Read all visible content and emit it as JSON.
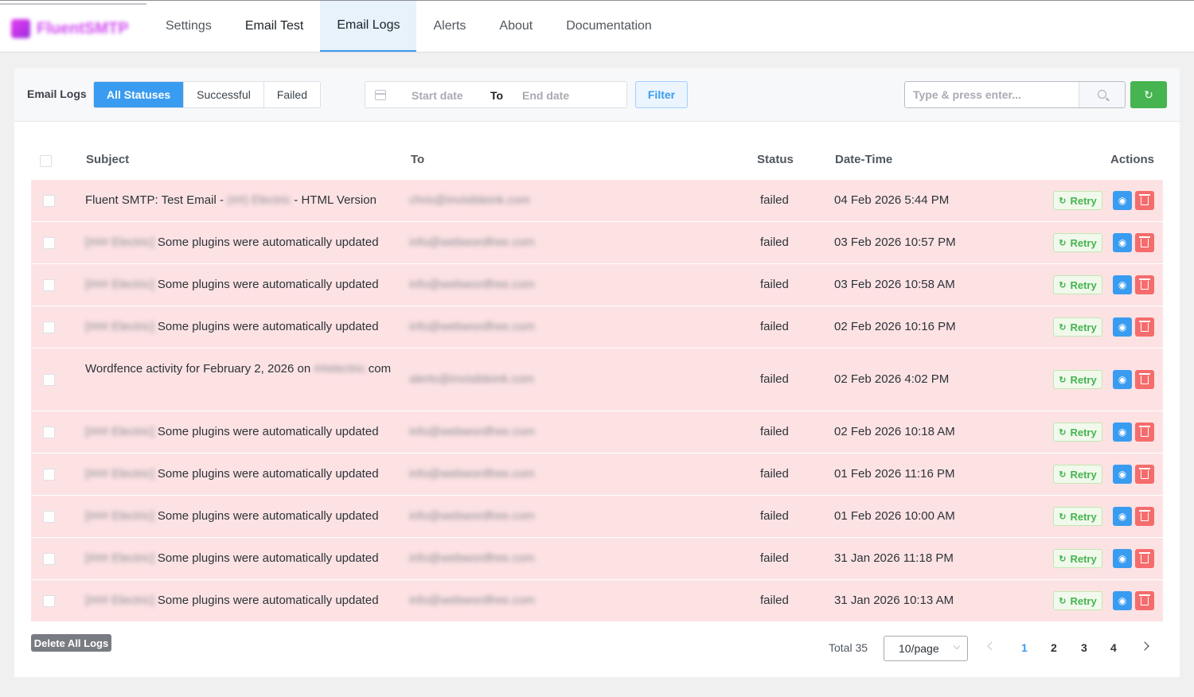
{
  "brand": {
    "logo_text": "FluentSMTP"
  },
  "nav": [
    {
      "label": "Settings"
    },
    {
      "label": "Email Test"
    },
    {
      "label": "Email Logs"
    },
    {
      "label": "Alerts"
    },
    {
      "label": "About"
    },
    {
      "label": "Documentation"
    }
  ],
  "toolbar": {
    "label": "Email Logs",
    "statuses": [
      "All Statuses",
      "Successful",
      "Failed"
    ],
    "date_start_placeholder": "Start date",
    "date_to": "To",
    "date_end_placeholder": "End date",
    "filter_label": "Filter",
    "search_placeholder": "Type & press enter...",
    "refresh_icon": "↻"
  },
  "table": {
    "headers": {
      "subject": "Subject",
      "to": "To",
      "status": "Status",
      "datetime": "Date-Time",
      "actions": "Actions"
    },
    "retry_label": "Retry",
    "retry_icon": "↻",
    "view_icon": "◉",
    "rows": [
      {
        "subject_pre": "Fluent SMTP: Test Email - ",
        "subject_blur": "(##) Electric",
        "subject_post": " - HTML Version",
        "to": "chris@invisibleink.com",
        "status": "failed",
        "datetime": "04 Feb 2026 5:44 PM"
      },
      {
        "subject_blur": "[### Electric] ",
        "subject_post": "Some plugins were automatically updated",
        "to": "info@webwordfree.com",
        "status": "failed",
        "datetime": "03 Feb 2026 10:57 PM"
      },
      {
        "subject_blur": "[### Electric] ",
        "subject_post": "Some plugins were automatically updated",
        "to": "info@webwordfree.com",
        "status": "failed",
        "datetime": "03 Feb 2026 10:58 AM"
      },
      {
        "subject_blur": "[### Electric] ",
        "subject_post": "Some plugins were automatically updated",
        "to": "info@webwordfree.com",
        "status": "failed",
        "datetime": "02 Feb 2026 10:16 PM"
      },
      {
        "subject_pre": "Wordfence activity for February 2, 2026 on ",
        "subject_blur": "##electric.",
        "subject_post": "com",
        "to": "alerts@invisibleink.com",
        "status": "failed",
        "datetime": "02 Feb 2026 4:02 PM",
        "tall": true
      },
      {
        "subject_blur": "[### Electric] ",
        "subject_post": "Some plugins were automatically updated",
        "to": "info@webwordfree.com",
        "status": "failed",
        "datetime": "02 Feb 2026 10:18 AM"
      },
      {
        "subject_blur": "[### Electric] ",
        "subject_post": "Some plugins were automatically updated",
        "to": "info@webwordfree.com",
        "status": "failed",
        "datetime": "01 Feb 2026 11:16 PM"
      },
      {
        "subject_blur": "[### Electric] ",
        "subject_post": "Some plugins were automatically updated",
        "to": "info@webwordfree.com",
        "status": "failed",
        "datetime": "01 Feb 2026 10:00 AM"
      },
      {
        "subject_blur": "[### Electric] ",
        "subject_post": "Some plugins were automatically updated",
        "to": "info@webwordfree.com",
        "status": "failed",
        "datetime": "31 Jan 2026 11:18 PM"
      },
      {
        "subject_blur": "[### Electric] ",
        "subject_post": "Some plugins were automatically updated",
        "to": "info@webwordfree.com",
        "status": "failed",
        "datetime": "31 Jan 2026 10:13 AM"
      }
    ]
  },
  "footer": {
    "delete_all_label": "Delete All Logs",
    "total_label": "Total 35",
    "page_size_label": "10/page",
    "pages": [
      "1",
      "2",
      "3",
      "4"
    ],
    "current_page": "1"
  },
  "colors": {
    "accent": "#3a9cf0",
    "success": "#46b450",
    "danger": "#f56c6c",
    "failed_row": "#fde2e4"
  }
}
